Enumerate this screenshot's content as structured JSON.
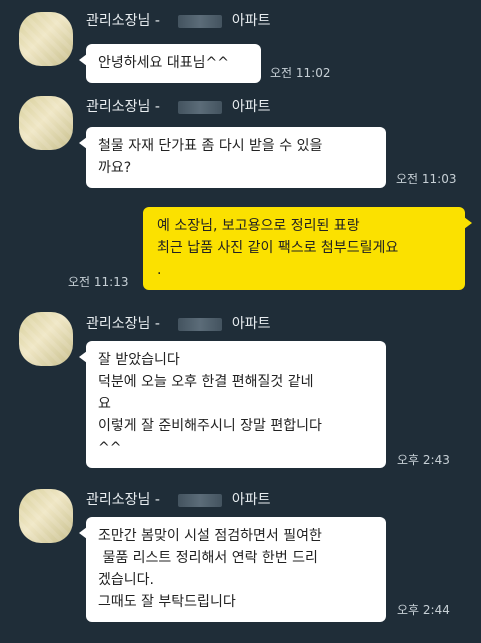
{
  "messages": [
    {
      "sender": "관리소장님 -",
      "sender_suffix": "아파트",
      "text": "안녕하세요 대표님^^",
      "time": "오전 11:02"
    },
    {
      "sender": "관리소장님 -",
      "sender_suffix": "아파트",
      "text": "철물 자재 단가표 좀 다시 받을 수 있을\n까요?",
      "time": "오전 11:03"
    },
    {
      "text": "예 소장님, 보고용으로 정리된 표랑\n최근 납품 사진 같이 팩스로 첨부드릴게요\n.",
      "time": "오전 11:13"
    },
    {
      "sender": "관리소장님 -",
      "sender_suffix": "아파트",
      "text": "잘 받았습니다\n덕분에 오늘 오후 한결 편해질것 같네\n요\n이렇게 잘 준비해주시니 장말 편합니다\n^^",
      "time": "오후 2:43"
    },
    {
      "sender": "관리소장님 -",
      "sender_suffix": "아파트",
      "text": "조만간 봄맞이 시설 점검하면서 필여한\n 물품 리스트 정리해서 연락 한번 드리\n겠습니다.\n그때도 잘 부탁드립니다",
      "time": "오후 2:44"
    }
  ]
}
